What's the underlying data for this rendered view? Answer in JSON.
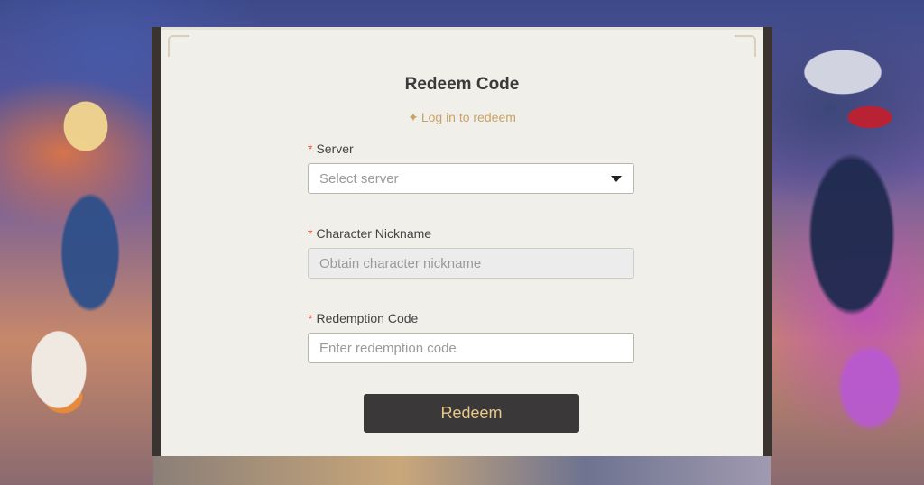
{
  "panel": {
    "title": "Redeem Code",
    "login_link": "Log in to redeem",
    "login_icon": "sparkle-icon"
  },
  "form": {
    "server": {
      "label": "Server",
      "required_mark": "*",
      "placeholder": "Select server"
    },
    "nickname": {
      "label": "Character Nickname",
      "required_mark": "*",
      "placeholder": "Obtain character nickname",
      "disabled": true
    },
    "code": {
      "label": "Redemption Code",
      "required_mark": "*",
      "placeholder": "Enter redemption code"
    },
    "submit_label": "Redeem"
  },
  "colors": {
    "accent": "#c9a265",
    "required": "#e0503a",
    "button_bg": "#3a3838",
    "button_text": "#e9c88a"
  }
}
